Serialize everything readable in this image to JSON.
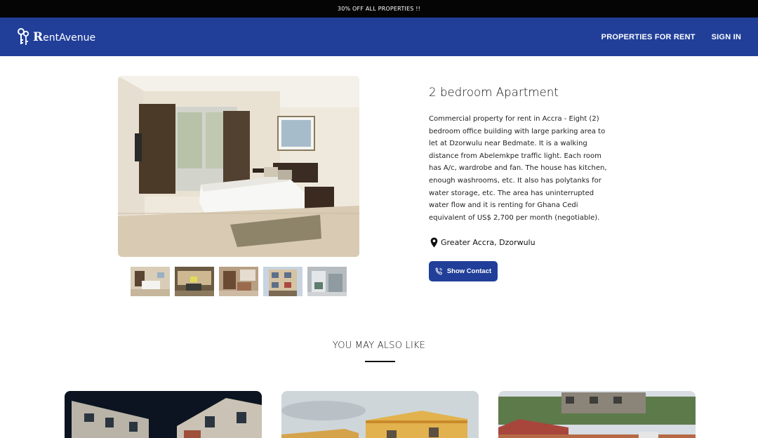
{
  "promo": {
    "text": "30% OFF ALL PROPERTIES !!"
  },
  "brand": {
    "first_letter": "R",
    "rest": "entAvenue"
  },
  "nav": {
    "properties_label": "PROPERTIES FOR RENT",
    "signin_label": "SIGN IN"
  },
  "listing": {
    "title": "2 bedroom Apartment",
    "description": "Commercial property for rent in Accra - Eight (2) bedroom office building with large parking area to let at Dzorwulu near Bedmate. It is a walking distance from Abelemkpe traffic light. Each room has A/c, wardrobe and fan. The house has kitchen, enough washrooms, etc. It also has polytanks for water storage, etc. The area has uninterrupted water flow and it is renting for Ghana Cedi equivalent of US$ 2,700 per month (negotiable).",
    "location": "Greater Accra, Dzorwulu",
    "contact_label": "Show Contact"
  },
  "related": {
    "heading": "YOU MAY ALSO LIKE"
  },
  "colors": {
    "primary": "#213f99",
    "promo_bg": "#050505"
  },
  "icons": [
    "keys-icon",
    "map-pin-icon",
    "phone-icon"
  ]
}
